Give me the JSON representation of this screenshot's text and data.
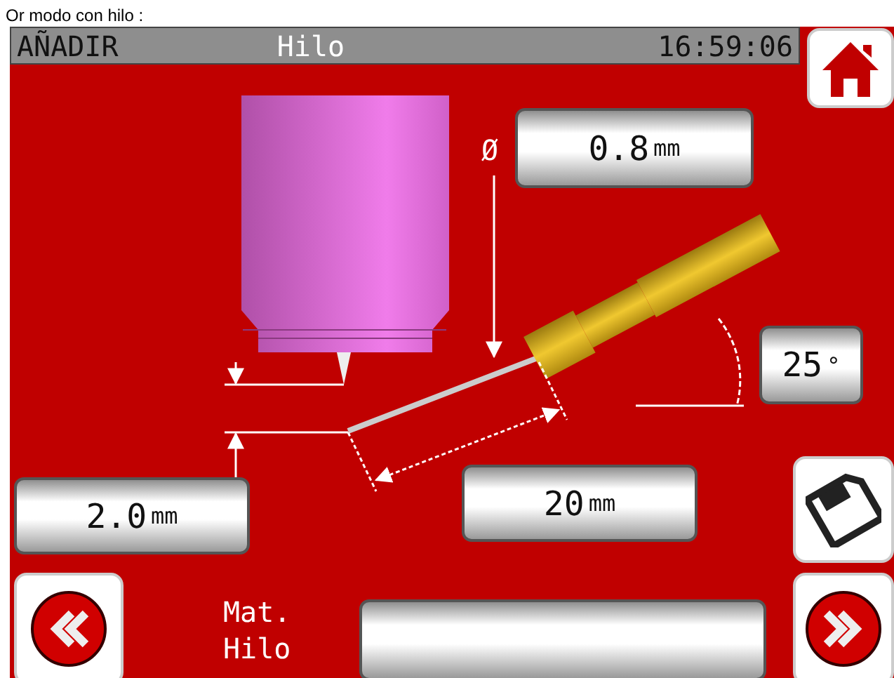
{
  "caption": "Or modo con hilo :",
  "header": {
    "mode": "AÑADIR",
    "title": "Hilo",
    "time": "16:59:06"
  },
  "fields": [
    {
      "kind": "diameter",
      "symbol": "Ø",
      "value": "0.8",
      "unit": "mm"
    },
    {
      "kind": "angle",
      "value": "25",
      "unit": "°"
    },
    {
      "kind": "height",
      "value": "2.0",
      "unit": "mm"
    },
    {
      "kind": "length",
      "value": "20",
      "unit": "mm"
    }
  ],
  "material": {
    "label": "Mat. Hilo"
  }
}
